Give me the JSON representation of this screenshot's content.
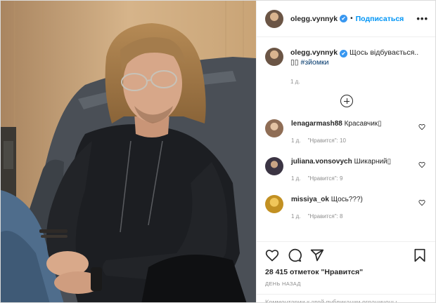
{
  "post": {
    "username": "olegg.vynnyk",
    "verified_mark": "✔",
    "separator": "•",
    "follow_label": "Подписаться",
    "more_label": "•••"
  },
  "caption": {
    "username": "olegg.vynnyk",
    "text": "Щось відбувається..",
    "emoji": "▯▯",
    "hashtag": "#зйомки",
    "time": "1 д."
  },
  "load_more_icon": "plus-circle-icon",
  "comments": [
    {
      "username": "lenagarmash88",
      "text": "Красавчик▯",
      "time": "1 д.",
      "likes": "\"Нравится\": 10"
    },
    {
      "username": "juliana.vonsovych",
      "text": "Шикарний▯",
      "time": "1 д.",
      "likes": "\"Нравится\": 9"
    },
    {
      "username": "missiya_ok",
      "text": "Щось???)",
      "time": "1 д.",
      "likes": "\"Нравится\": 8"
    }
  ],
  "actions": {
    "icons": [
      "heart-icon",
      "comment-icon",
      "share-icon",
      "bookmark-icon"
    ],
    "likes_text": "28 415 отметок \"Нравится\"",
    "post_date": "День назад"
  },
  "footer": {
    "comments_closed": "Комментарии к этой публикации ограничены"
  },
  "colors": {
    "link_blue": "#0095f6",
    "verified_blue": "#3897f0",
    "hashtag": "#00376b",
    "muted": "#8e8e8e"
  }
}
